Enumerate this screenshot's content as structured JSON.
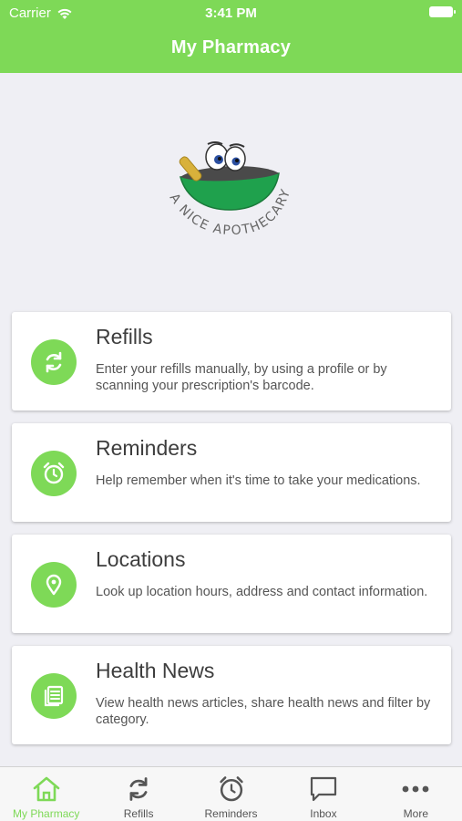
{
  "status_bar": {
    "carrier": "Carrier",
    "time": "3:41 PM"
  },
  "nav": {
    "title": "My Pharmacy"
  },
  "logo": {
    "brand_text": "A NICE APOTHECARY"
  },
  "cards": [
    {
      "title": "Refills",
      "description": "Enter your refills manually, by using a profile or by scanning your prescription's barcode.",
      "icon": "refresh-icon"
    },
    {
      "title": "Reminders",
      "description": "Help remember when it's time to take your medications.",
      "icon": "alarm-clock-icon"
    },
    {
      "title": "Locations",
      "description": "Look up location hours, address and contact information.",
      "icon": "location-pin-icon"
    },
    {
      "title": "Health News",
      "description": "View health news articles, share health news and filter by category.",
      "icon": "news-icon"
    }
  ],
  "tabbar": {
    "items": [
      {
        "label": "My Pharmacy",
        "icon": "home-icon",
        "active": true
      },
      {
        "label": "Refills",
        "icon": "refresh-icon",
        "active": false
      },
      {
        "label": "Reminders",
        "icon": "alarm-clock-icon",
        "active": false
      },
      {
        "label": "Inbox",
        "icon": "chat-bubble-icon",
        "active": false
      },
      {
        "label": "More",
        "icon": "more-dots-icon",
        "active": false
      }
    ]
  },
  "colors": {
    "brand_green": "#7ed957",
    "background": "#efeff4",
    "tab_inactive": "#555555"
  }
}
